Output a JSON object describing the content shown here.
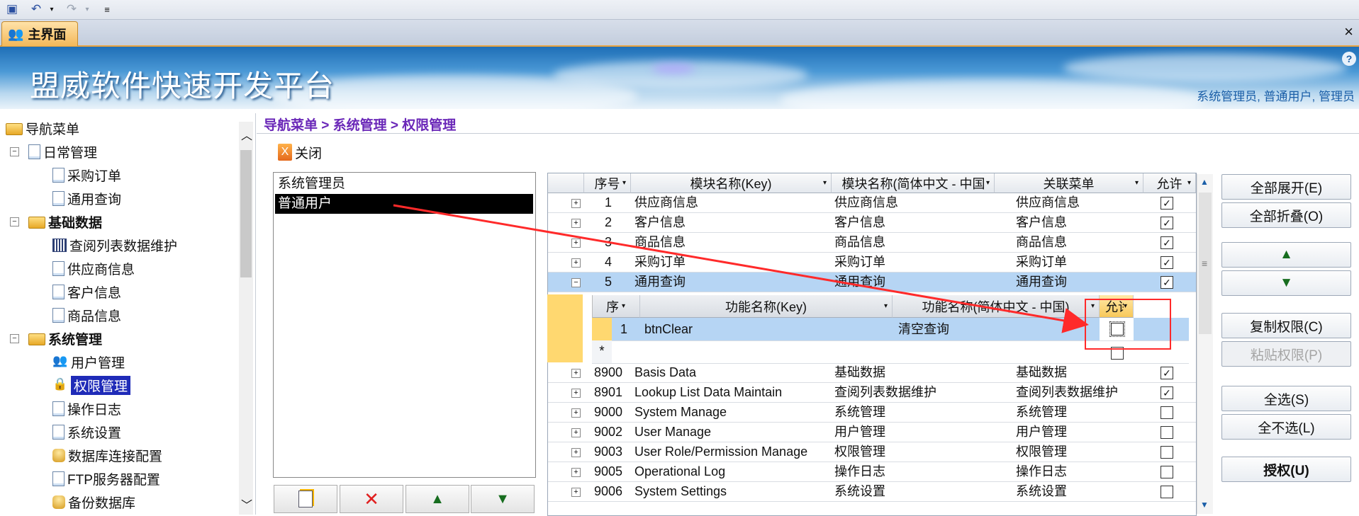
{
  "tabs": {
    "main_tab": "主界面",
    "close": "×"
  },
  "banner": {
    "title": "盟威软件快速开发平台",
    "users": "系统管理员, 普通用户, 管理员",
    "help": "?"
  },
  "nav": {
    "items": [
      {
        "label": "导航菜单",
        "level": 0,
        "icon": "folder-icon",
        "bold": false
      },
      {
        "label": "日常管理",
        "level": 1,
        "icon": "document-icon",
        "bold": false
      },
      {
        "label": "采购订单",
        "level": 2,
        "icon": "document-icon",
        "bold": false
      },
      {
        "label": "通用查询",
        "level": 2,
        "icon": "document-icon",
        "bold": false
      },
      {
        "label": "基础数据",
        "level": 1,
        "icon": "folder-icon",
        "bold": true
      },
      {
        "label": "查阅列表数据维护",
        "level": 2,
        "icon": "grid-icon",
        "bold": false
      },
      {
        "label": "供应商信息",
        "level": 2,
        "icon": "document-icon",
        "bold": false
      },
      {
        "label": "客户信息",
        "level": 2,
        "icon": "document-icon",
        "bold": false
      },
      {
        "label": "商品信息",
        "level": 2,
        "icon": "document-icon",
        "bold": false
      },
      {
        "label": "系统管理",
        "level": 1,
        "icon": "folder-icon",
        "bold": true
      },
      {
        "label": "用户管理",
        "level": 2,
        "icon": "users-icon",
        "bold": false
      },
      {
        "label": "权限管理",
        "level": 2,
        "icon": "lock-icon",
        "bold": false,
        "selected": true
      },
      {
        "label": "操作日志",
        "level": 2,
        "icon": "document-icon",
        "bold": false
      },
      {
        "label": "系统设置",
        "level": 2,
        "icon": "settings-icon",
        "bold": false
      },
      {
        "label": "数据库连接配置",
        "level": 2,
        "icon": "database-icon",
        "bold": false
      },
      {
        "label": "FTP服务器配置",
        "level": 2,
        "icon": "server-icon",
        "bold": false
      },
      {
        "label": "备份数据库",
        "level": 2,
        "icon": "database-icon",
        "bold": false
      }
    ]
  },
  "breadcrumb": {
    "text": "导航菜单 > 系统管理 > 权限管理"
  },
  "toolbar": {
    "close_label": "关闭"
  },
  "roles": {
    "items": [
      "系统管理员",
      "普通用户"
    ],
    "selected": "普通用户"
  },
  "grid": {
    "headers": [
      "序号",
      "模块名称(Key)",
      "模块名称(简体中文 - 中国)",
      "关联菜单",
      "允许"
    ],
    "rows": [
      {
        "no": "1",
        "key": "供应商信息",
        "cn": "供应商信息",
        "menu": "供应商信息",
        "allow": true
      },
      {
        "no": "2",
        "key": "客户信息",
        "cn": "客户信息",
        "menu": "客户信息",
        "allow": true
      },
      {
        "no": "3",
        "key": "商品信息",
        "cn": "商品信息",
        "menu": "商品信息",
        "allow": true
      },
      {
        "no": "4",
        "key": "采购订单",
        "cn": "采购订单",
        "menu": "采购订单",
        "allow": true
      },
      {
        "no": "5",
        "key": "通用查询",
        "cn": "通用查询",
        "menu": "通用查询",
        "allow": true
      },
      {
        "no": "8900",
        "key": "Basis Data",
        "cn": "基础数据",
        "menu": "基础数据",
        "allow": true
      },
      {
        "no": "8901",
        "key": "Lookup List Data Maintain",
        "cn": "查阅列表数据维护",
        "menu": "查阅列表数据维护",
        "allow": true
      },
      {
        "no": "9000",
        "key": "System Manage",
        "cn": "系统管理",
        "menu": "系统管理",
        "allow": false
      },
      {
        "no": "9002",
        "key": "User Manage",
        "cn": "用户管理",
        "menu": "用户管理",
        "allow": false
      },
      {
        "no": "9003",
        "key": "User Role/Permission Manage",
        "cn": "权限管理",
        "menu": "权限管理",
        "allow": false
      },
      {
        "no": "9005",
        "key": "Operational Log",
        "cn": "操作日志",
        "menu": "操作日志",
        "allow": false
      },
      {
        "no": "9006",
        "key": "System Settings",
        "cn": "系统设置",
        "menu": "系统设置",
        "allow": false
      }
    ]
  },
  "subgrid": {
    "headers": [
      "序",
      "功能名称(Key)",
      "功能名称(简体中文 - 中国)",
      "允许"
    ],
    "header_short_allow": "允许",
    "rows": [
      {
        "no": "1",
        "key": "btnClear",
        "cn": "清空查询",
        "allow": false
      }
    ],
    "new_row_marker": "*"
  },
  "buttons": {
    "expand_all": "全部展开(E)",
    "collapse_all": "全部折叠(O)",
    "copy_perm": "复制权限(C)",
    "paste_perm": "粘贴权限(P)",
    "select_all": "全选(S)",
    "select_none": "全不选(L)",
    "authorize": "授权(U)"
  },
  "colors": {
    "accent": "#6a27b8",
    "banner": "#1f6fb7",
    "selection": "#b6d5f4",
    "annotation": "#ff2a2a"
  }
}
